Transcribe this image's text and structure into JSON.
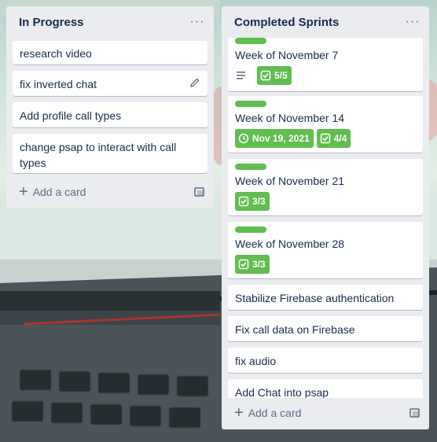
{
  "colors": {
    "label_green": "#61bd4f",
    "list_bg": "#ebecf0",
    "text": "#172b4d",
    "muted": "#5e6c84"
  },
  "lists": {
    "in_progress": {
      "title": "In Progress",
      "cards": [
        {
          "title": "research video"
        },
        {
          "title": "fix inverted chat"
        },
        {
          "title": "Add profile call types"
        },
        {
          "title": "change psap to interact with call types"
        }
      ],
      "add_card_label": "Add a card"
    },
    "completed": {
      "title": "Completed Sprints",
      "cards": [
        {
          "title": "Week of November 7",
          "checklist": "5/5",
          "has_description": true
        },
        {
          "title": "Week of November 14",
          "due": "Nov 19, 2021",
          "checklist": "4/4"
        },
        {
          "title": "Week of November 21",
          "checklist": "3/3"
        },
        {
          "title": "Week of November 28",
          "checklist": "3/3"
        },
        {
          "title": "Stabilize Firebase authentication"
        },
        {
          "title": "Fix call data on Firebase"
        },
        {
          "title": "fix audio"
        },
        {
          "title": "Add Chat into psap"
        }
      ],
      "add_card_label": "Add a card"
    }
  },
  "icons": {
    "menu": "ellipsis-icon",
    "edit": "pencil-icon",
    "template": "card-template-icon",
    "checklist": "checkbox-icon",
    "due": "clock-icon",
    "description": "description-icon",
    "add": "plus-icon"
  }
}
